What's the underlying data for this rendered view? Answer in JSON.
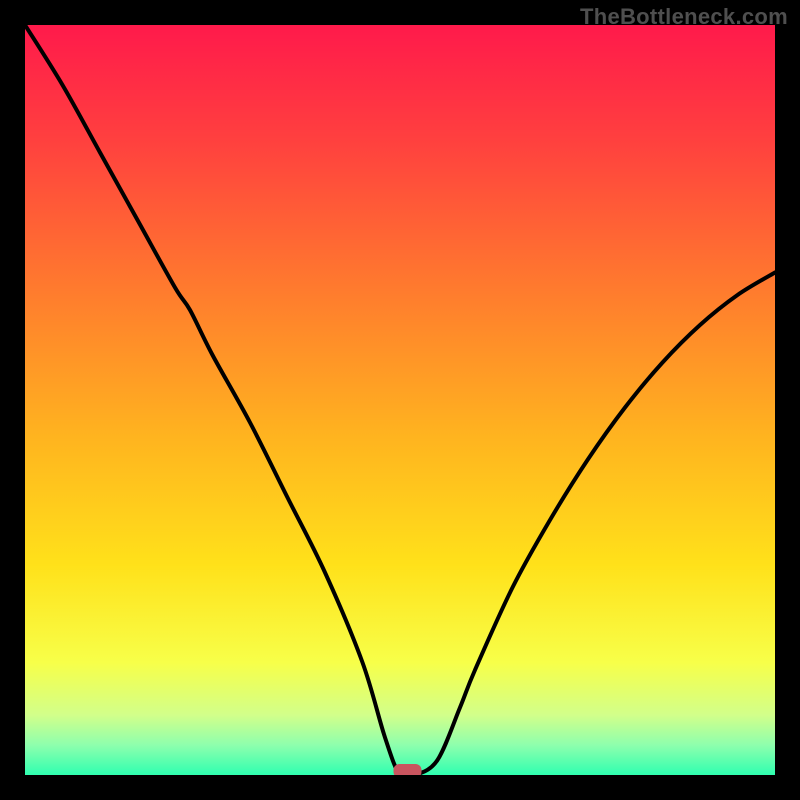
{
  "watermark": "TheBottleneck.com",
  "chart_data": {
    "type": "line",
    "title": "",
    "xlabel": "",
    "ylabel": "",
    "xlim": [
      0,
      100
    ],
    "ylim": [
      0,
      100
    ],
    "grid": false,
    "legend": false,
    "annotations": [],
    "series": [
      {
        "name": "bottleneck-curve",
        "x": [
          0,
          5,
          10,
          15,
          20,
          22,
          25,
          30,
          35,
          40,
          45,
          48,
          50,
          52,
          55,
          58,
          60,
          65,
          70,
          75,
          80,
          85,
          90,
          95,
          100
        ],
        "y": [
          100,
          92,
          83,
          74,
          65,
          62,
          56,
          47,
          37,
          27,
          15,
          5,
          0,
          0,
          2,
          9,
          14,
          25,
          34,
          42,
          49,
          55,
          60,
          64,
          67
        ]
      }
    ],
    "marker": {
      "name": "optimal-point",
      "x": 51,
      "y": 0,
      "color": "#c9555f"
    },
    "background_gradient": {
      "stops": [
        {
          "pos": 0.0,
          "color": "#ff1a4b"
        },
        {
          "pos": 0.15,
          "color": "#ff3f3f"
        },
        {
          "pos": 0.35,
          "color": "#ff7a2e"
        },
        {
          "pos": 0.55,
          "color": "#ffb41f"
        },
        {
          "pos": 0.72,
          "color": "#ffe11a"
        },
        {
          "pos": 0.85,
          "color": "#f7ff49"
        },
        {
          "pos": 0.92,
          "color": "#d2ff8a"
        },
        {
          "pos": 0.96,
          "color": "#8effad"
        },
        {
          "pos": 1.0,
          "color": "#2fffb0"
        }
      ]
    }
  }
}
